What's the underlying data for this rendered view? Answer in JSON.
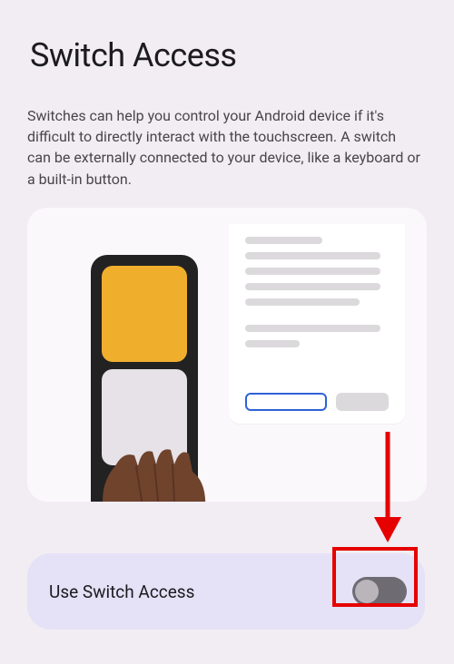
{
  "page": {
    "title": "Switch Access",
    "description": "Switches can help you control your Android device if it's difficult to directly interact with the touchscreen. A switch can be externally connected to your device, like a keyboard or a built-in button."
  },
  "toggle": {
    "label": "Use Switch Access",
    "state": "off"
  },
  "annotation": {
    "arrow_color": "#e60000",
    "highlight_color": "#e60000"
  }
}
